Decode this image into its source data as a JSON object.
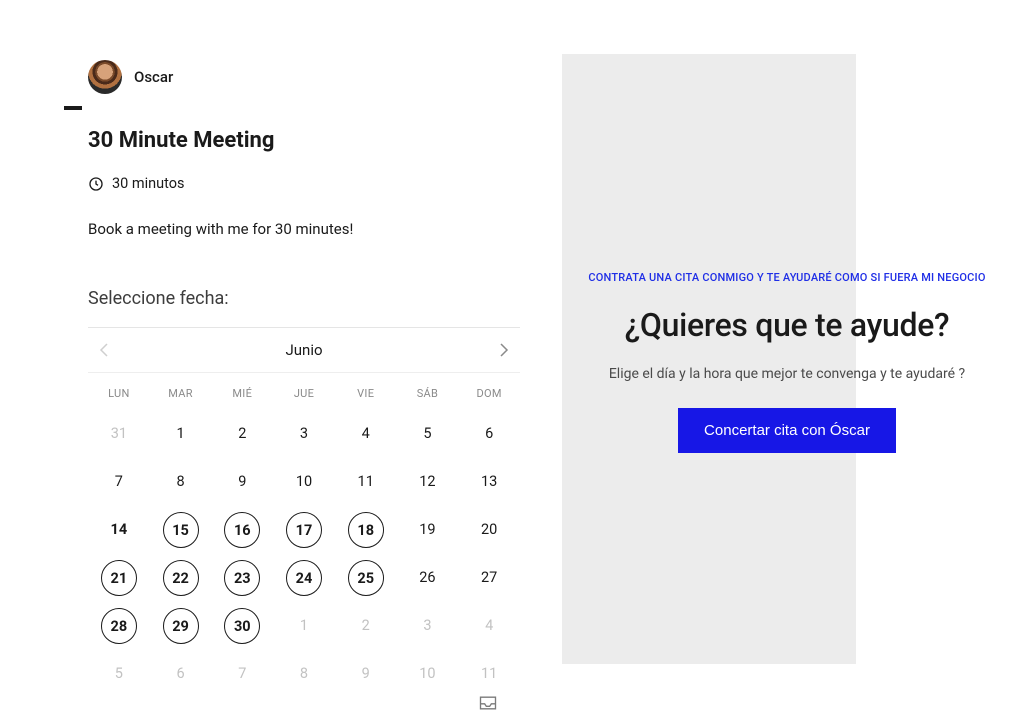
{
  "host": {
    "name": "Oscar"
  },
  "meeting": {
    "title": "30 Minute Meeting",
    "duration_label": "30 minutos",
    "description": "Book a meeting with me for 30 minutes!"
  },
  "calendar": {
    "select_label": "Seleccione fecha:",
    "month": "Junio",
    "dow": [
      "LUN",
      "MAR",
      "MIÉ",
      "JUE",
      "VIE",
      "SÁB",
      "DOM"
    ],
    "days": [
      {
        "n": "31",
        "state": "muted"
      },
      {
        "n": "1"
      },
      {
        "n": "2"
      },
      {
        "n": "3"
      },
      {
        "n": "4"
      },
      {
        "n": "5"
      },
      {
        "n": "6"
      },
      {
        "n": "7"
      },
      {
        "n": "8"
      },
      {
        "n": "9"
      },
      {
        "n": "10"
      },
      {
        "n": "11"
      },
      {
        "n": "12"
      },
      {
        "n": "13"
      },
      {
        "n": "14",
        "state": "current-strong"
      },
      {
        "n": "15",
        "state": "available"
      },
      {
        "n": "16",
        "state": "available"
      },
      {
        "n": "17",
        "state": "available"
      },
      {
        "n": "18",
        "state": "available"
      },
      {
        "n": "19"
      },
      {
        "n": "20"
      },
      {
        "n": "21",
        "state": "available"
      },
      {
        "n": "22",
        "state": "available"
      },
      {
        "n": "23",
        "state": "available"
      },
      {
        "n": "24",
        "state": "available"
      },
      {
        "n": "25",
        "state": "available"
      },
      {
        "n": "26"
      },
      {
        "n": "27"
      },
      {
        "n": "28",
        "state": "available"
      },
      {
        "n": "29",
        "state": "available"
      },
      {
        "n": "30",
        "state": "available"
      },
      {
        "n": "1",
        "state": "muted"
      },
      {
        "n": "2",
        "state": "muted"
      },
      {
        "n": "3",
        "state": "muted"
      },
      {
        "n": "4",
        "state": "muted"
      },
      {
        "n": "5",
        "state": "muted"
      },
      {
        "n": "6",
        "state": "muted"
      },
      {
        "n": "7",
        "state": "muted"
      },
      {
        "n": "8",
        "state": "muted"
      },
      {
        "n": "9",
        "state": "muted"
      },
      {
        "n": "10",
        "state": "muted"
      },
      {
        "n": "11",
        "state": "muted"
      }
    ]
  },
  "promo": {
    "eyebrow": "CONTRATA UNA CITA CONMIGO Y TE AYUDARÉ COMO SI FUERA MI NEGOCIO",
    "title": "¿Quieres que te ayude?",
    "subtitle": "Elige el día y la hora que mejor te convenga y te ayudaré ?",
    "cta": "Concertar cita con Óscar"
  }
}
